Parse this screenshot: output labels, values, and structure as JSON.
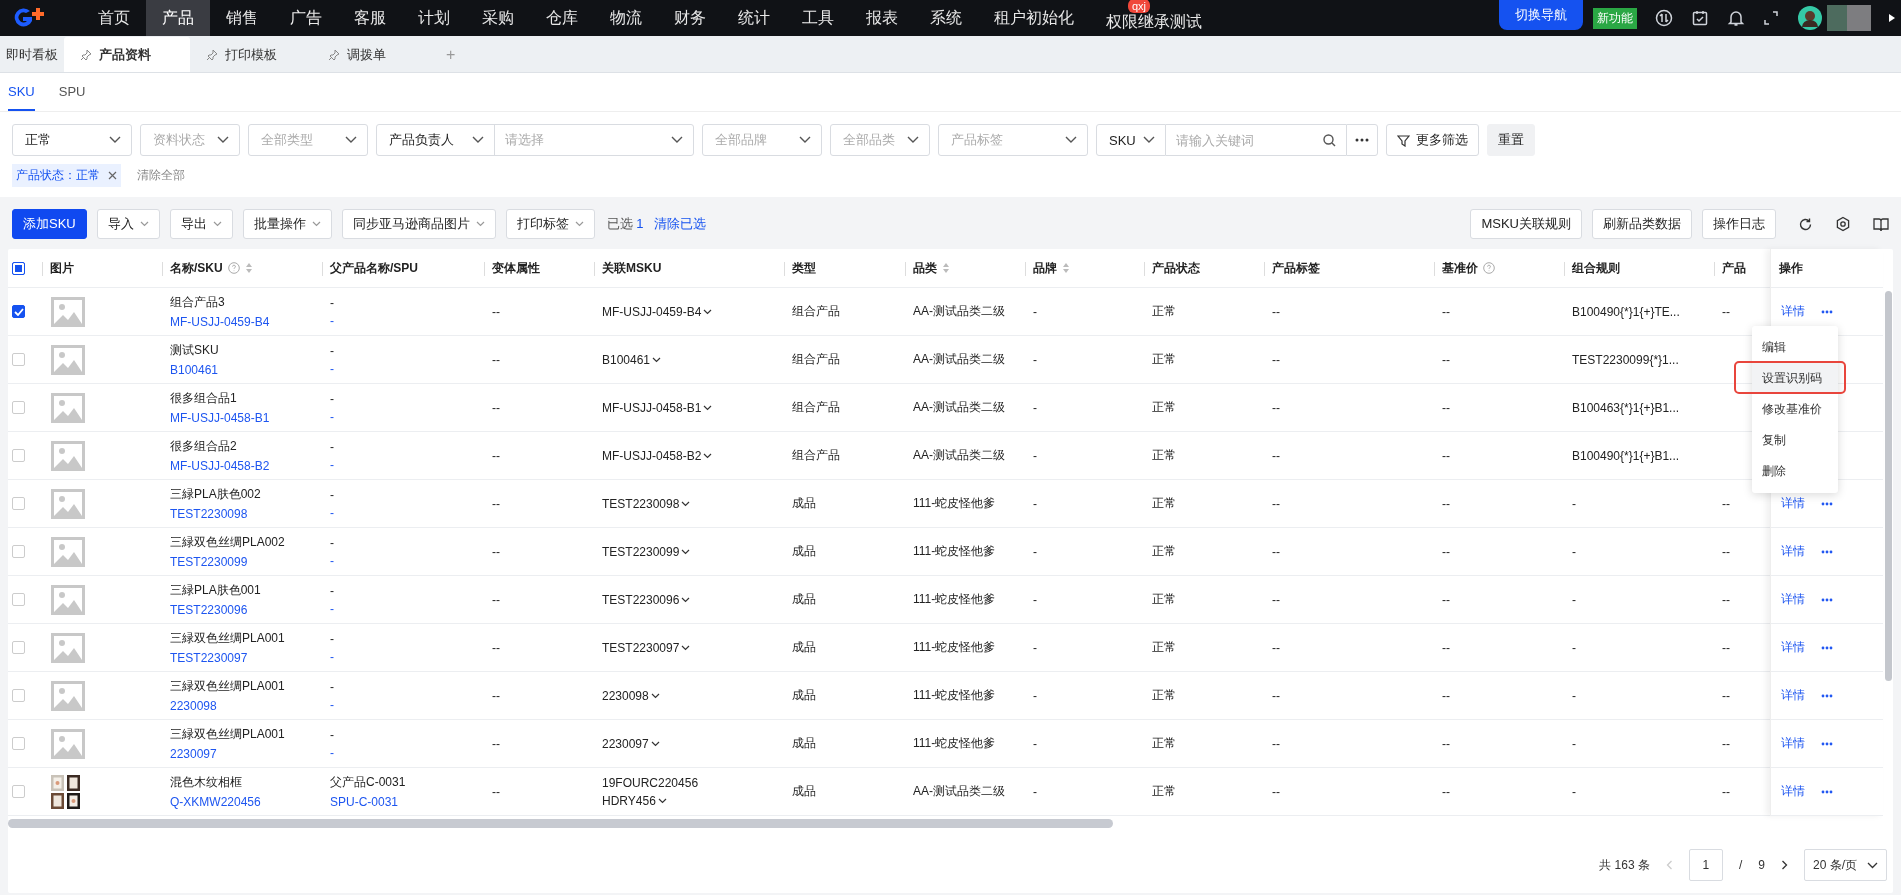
{
  "top_nav": {
    "items": [
      {
        "label": "首页",
        "selected": false
      },
      {
        "label": "产品",
        "selected": true
      },
      {
        "label": "销售",
        "selected": false
      },
      {
        "label": "广告",
        "selected": false
      },
      {
        "label": "客服",
        "selected": false
      },
      {
        "label": "计划",
        "selected": false
      },
      {
        "label": "采购",
        "selected": false
      },
      {
        "label": "仓库",
        "selected": false
      },
      {
        "label": "物流",
        "selected": false
      },
      {
        "label": "财务",
        "selected": false
      },
      {
        "label": "统计",
        "selected": false
      },
      {
        "label": "工具",
        "selected": false
      },
      {
        "label": "报表",
        "selected": false
      },
      {
        "label": "系统",
        "selected": false
      },
      {
        "label": "租户初始化",
        "selected": false
      },
      {
        "label": "权限继承测试",
        "selected": false,
        "badge": "qxj"
      }
    ],
    "switch_nav": "切换导航",
    "new_feature": "新功能"
  },
  "page_tabs": [
    {
      "label": "即时看板",
      "pinned": false,
      "selected": false
    },
    {
      "label": "产品资料",
      "pinned": true,
      "selected": true
    },
    {
      "label": "打印模板",
      "pinned": true,
      "selected": false
    },
    {
      "label": "调拨单",
      "pinned": true,
      "selected": false
    }
  ],
  "add_tab": "+",
  "sub_tabs": [
    {
      "label": "SKU",
      "selected": true
    },
    {
      "label": "SPU",
      "selected": false
    }
  ],
  "filters": [
    {
      "kind": "select",
      "value": "正常"
    },
    {
      "kind": "select",
      "placeholder": "资料状态"
    },
    {
      "kind": "select",
      "placeholder": "全部类型"
    },
    {
      "kind": "combo",
      "label": "产品负责人",
      "placeholder": "请选择"
    },
    {
      "kind": "select",
      "placeholder": "全部品牌"
    },
    {
      "kind": "select",
      "placeholder": "全部品类"
    },
    {
      "kind": "select",
      "placeholder": "产品标签"
    },
    {
      "kind": "search",
      "label": "SKU",
      "placeholder": "请输入关键词"
    }
  ],
  "more_filters": "更多筛选",
  "reset": "重置",
  "active_filters": [
    {
      "label": "产品状态：正常"
    }
  ],
  "clear_all": "清除全部",
  "toolbar": {
    "primary": "添加SKU",
    "dropdowns": [
      "导入",
      "导出",
      "批量操作",
      "同步亚马逊商品图片",
      "打印标签"
    ],
    "selected_label": "已选",
    "selected_count": "1",
    "clear_selected": "清除已选",
    "right_buttons": [
      "MSKU关联规则",
      "刷新品类数据",
      "操作日志"
    ]
  },
  "table": {
    "some_selected": true,
    "columns": [
      {
        "label": "图片",
        "help": false,
        "sortable": false
      },
      {
        "label": "名称/SKU",
        "help": true,
        "sortable": true
      },
      {
        "label": "父产品名称/SPU",
        "help": false,
        "sortable": false
      },
      {
        "label": "变体属性",
        "help": false,
        "sortable": false
      },
      {
        "label": "关联MSKU",
        "help": false,
        "sortable": false
      },
      {
        "label": "类型",
        "help": false,
        "sortable": false
      },
      {
        "label": "品类",
        "help": false,
        "sortable": true
      },
      {
        "label": "品牌",
        "help": false,
        "sortable": true
      },
      {
        "label": "产品状态",
        "help": false,
        "sortable": false
      },
      {
        "label": "产品标签",
        "help": false,
        "sortable": false
      },
      {
        "label": "基准价",
        "help": true,
        "sortable": false
      },
      {
        "label": "组合规则",
        "help": false,
        "sortable": false
      },
      {
        "label": "产品",
        "help": false,
        "sortable": false
      },
      {
        "label": "操作",
        "help": false,
        "sortable": false
      }
    ],
    "rows": [
      {
        "checked": true,
        "name": "组合产品3",
        "sku": "MF-USJJ-0459-B4",
        "parent": "-",
        "spu": "-",
        "variant": "--",
        "msku": [
          "MF-USJJ-0459-B4"
        ],
        "type": "组合产品",
        "category": "AA-测试品类二级",
        "brand": "-",
        "status": "正常",
        "tags": "--",
        "base_price": "--",
        "combo_rule": "B100490{*}1{+}TE...",
        "column_13": "--",
        "action": "详情"
      },
      {
        "checked": false,
        "name": "测试SKU",
        "sku": "B100461",
        "parent": "-",
        "spu": "-",
        "variant": "--",
        "msku": [
          "B100461"
        ],
        "type": "组合产品",
        "category": "AA-测试品类二级",
        "brand": "-",
        "status": "正常",
        "tags": "--",
        "base_price": "--",
        "combo_rule": "TEST2230099{*}1..."
      },
      {
        "checked": false,
        "name": "很多组合品1",
        "sku": "MF-USJJ-0458-B1",
        "parent": "-",
        "spu": "-",
        "variant": "--",
        "msku": [
          "MF-USJJ-0458-B1"
        ],
        "type": "组合产品",
        "category": "AA-测试品类二级",
        "brand": "-",
        "status": "正常",
        "tags": "--",
        "base_price": "--",
        "combo_rule": "B100463{*}1{+}B1..."
      },
      {
        "checked": false,
        "name": "很多组合品2",
        "sku": "MF-USJJ-0458-B2",
        "parent": "-",
        "spu": "-",
        "variant": "--",
        "msku": [
          "MF-USJJ-0458-B2"
        ],
        "type": "组合产品",
        "category": "AA-测试品类二级",
        "brand": "-",
        "status": "正常",
        "tags": "--",
        "base_price": "--",
        "combo_rule": "B100490{*}1{+}B1..."
      },
      {
        "checked": false,
        "name": "三緑PLA肤色002",
        "sku": "TEST2230098",
        "parent": "-",
        "spu": "-",
        "variant": "--",
        "msku": [
          "TEST2230098"
        ],
        "type": "成品",
        "category": "111-蛇皮怪他爹",
        "brand": "-",
        "status": "正常",
        "tags": "--",
        "base_price": "--",
        "combo_rule": "-",
        "column_13": "--",
        "action": "详情"
      },
      {
        "checked": false,
        "name": "三緑双色丝绸PLA002",
        "sku": "TEST2230099",
        "parent": "-",
        "spu": "-",
        "variant": "--",
        "msku": [
          "TEST2230099"
        ],
        "type": "成品",
        "category": "111-蛇皮怪他爹",
        "brand": "-",
        "status": "正常",
        "tags": "--",
        "base_price": "--",
        "combo_rule": "-",
        "column_13": "--",
        "action": "详情"
      },
      {
        "checked": false,
        "name": "三緑PLA肤色001",
        "sku": "TEST2230096",
        "parent": "-",
        "spu": "-",
        "variant": "--",
        "msku": [
          "TEST2230096"
        ],
        "type": "成品",
        "category": "111-蛇皮怪他爹",
        "brand": "-",
        "status": "正常",
        "tags": "--",
        "base_price": "--",
        "combo_rule": "-",
        "column_13": "--",
        "action": "详情"
      },
      {
        "checked": false,
        "name": "三緑双色丝绸PLA001",
        "sku": "TEST2230097",
        "parent": "-",
        "spu": "-",
        "variant": "--",
        "msku": [
          "TEST2230097"
        ],
        "type": "成品",
        "category": "111-蛇皮怪他爹",
        "brand": "-",
        "status": "正常",
        "tags": "--",
        "base_price": "--",
        "combo_rule": "-",
        "column_13": "--",
        "action": "详情"
      },
      {
        "checked": false,
        "name": "三緑双色丝绸PLA001",
        "sku": "2230098",
        "parent": "-",
        "spu": "-",
        "variant": "--",
        "msku": [
          "2230098"
        ],
        "type": "成品",
        "category": "111-蛇皮怪他爹",
        "brand": "-",
        "status": "正常",
        "tags": "--",
        "base_price": "--",
        "combo_rule": "-",
        "column_13": "--",
        "action": "详情"
      },
      {
        "checked": false,
        "name": "三緑双色丝绸PLA001",
        "sku": "2230097",
        "parent": "-",
        "spu": "-",
        "variant": "--",
        "msku": [
          "2230097"
        ],
        "type": "成品",
        "category": "111-蛇皮怪他爹",
        "brand": "-",
        "status": "正常",
        "tags": "--",
        "base_price": "--",
        "combo_rule": "-",
        "column_13": "--",
        "action": "详情"
      },
      {
        "checked": false,
        "kind": "picture",
        "name": "混色木纹相框",
        "sku": "Q-XKMW220456",
        "parent": "父产品C-0031",
        "spu": "SPU-C-0031",
        "variant": "--",
        "msku": [
          "19FOURC220456",
          "HDRY456"
        ],
        "type": "成品",
        "category": "AA-测试品类二级",
        "brand": "-",
        "status": "正常",
        "tags": "--",
        "base_price": "--",
        "combo_rule": "-",
        "column_13": "--",
        "action": "详情"
      }
    ]
  },
  "row_menu": {
    "items": [
      {
        "label": "编辑",
        "highlighted": false
      },
      {
        "label": "设置识别码",
        "highlighted": true
      },
      {
        "label": "修改基准价",
        "highlighted": false
      },
      {
        "label": "复制",
        "highlighted": false
      },
      {
        "label": "删除",
        "highlighted": false
      }
    ]
  },
  "pagination": {
    "total": "共 163 条",
    "page": "1",
    "separator": "/",
    "page_count": "9",
    "page_size": "20 条/页"
  }
}
